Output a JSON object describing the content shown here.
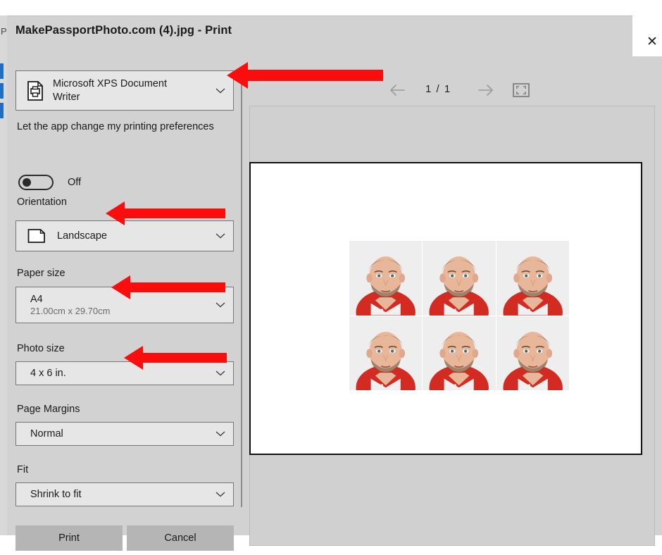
{
  "window": {
    "title": "MakePassportPhoto.com (4).jpg - Print",
    "close_label": "✕"
  },
  "settings": {
    "printer": {
      "name_line1": "Microsoft XPS Document",
      "name_line2": "Writer",
      "icon": "printer-document-icon"
    },
    "app_preferences": {
      "label": "Let the app change my printing preferences",
      "toggle_state": "Off"
    },
    "orientation": {
      "label": "Orientation",
      "value": "Landscape",
      "icon": "landscape-page-icon"
    },
    "paper_size": {
      "label": "Paper size",
      "value": "A4",
      "dimensions": "21.00cm x 29.70cm"
    },
    "photo_size": {
      "label": "Photo size",
      "value": "4 x 6 in."
    },
    "page_margins": {
      "label": "Page Margins",
      "value": "Normal"
    },
    "fit": {
      "label": "Fit",
      "value": "Shrink to fit"
    },
    "buttons": {
      "print": "Print",
      "cancel": "Cancel"
    }
  },
  "preview": {
    "prev_page_icon": "arrow-left-icon",
    "next_page_icon": "arrow-right-icon",
    "page_indicator": "1 / 1",
    "fit_to_page_icon": "fit-to-page-icon",
    "photo_count": 6,
    "photo_description": "passport photo of man in red polo shirt"
  },
  "annotations": {
    "arrow_color": "#f90d0d",
    "arrows": [
      {
        "target": "printer-combo",
        "points_to": "printer dropdown"
      },
      {
        "target": "orientation-combo",
        "points_to": "Landscape orientation"
      },
      {
        "target": "paper-size-combo",
        "points_to": "A4 paper size"
      },
      {
        "target": "photo-size-combo",
        "points_to": "4 x 6 in. photo size"
      }
    ]
  },
  "background": {
    "ghost_letter": "P"
  }
}
